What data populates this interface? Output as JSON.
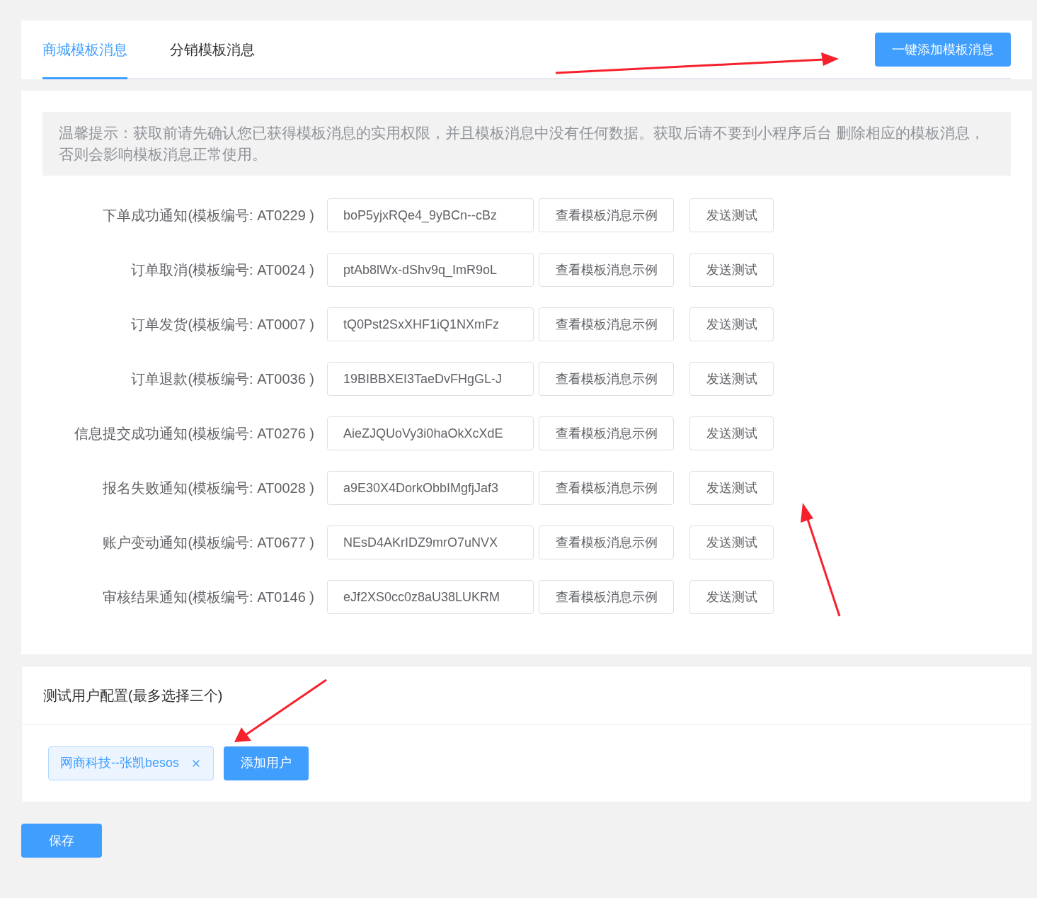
{
  "tabs": [
    {
      "label": "商城模板消息",
      "selected": true
    },
    {
      "label": "分销模板消息",
      "selected": false
    }
  ],
  "add_all_button": "一键添加模板消息",
  "notice": "温馨提示：获取前请先确认您已获得模板消息的实用权限，并且模板消息中没有任何数据。获取后请不要到小程序后台 删除相应的模板消息，否则会影响模板消息正常使用。",
  "templates": [
    {
      "label": "下单成功通知(模板编号: AT0229 )",
      "value": "boP5yjxRQe4_9yBCn--cBz",
      "view_button": "查看模板消息示例",
      "test_button": "发送测试"
    },
    {
      "label": "订单取消(模板编号: AT0024 )",
      "value": "ptAb8lWx-dShv9q_ImR9oL",
      "view_button": "查看模板消息示例",
      "test_button": "发送测试"
    },
    {
      "label": "订单发货(模板编号: AT0007 )",
      "value": "tQ0Pst2SxXHF1iQ1NXmFz",
      "view_button": "查看模板消息示例",
      "test_button": "发送测试"
    },
    {
      "label": "订单退款(模板编号: AT0036 )",
      "value": "19BIBBXEI3TaeDvFHgGL-J",
      "view_button": "查看模板消息示例",
      "test_button": "发送测试"
    },
    {
      "label": "信息提交成功通知(模板编号: AT0276 )",
      "value": "AieZJQUoVy3i0haOkXcXdE",
      "view_button": "查看模板消息示例",
      "test_button": "发送测试"
    },
    {
      "label": "报名失败通知(模板编号: AT0028 )",
      "value": "a9E30X4DorkObbIMgfjJaf3",
      "view_button": "查看模板消息示例",
      "test_button": "发送测试"
    },
    {
      "label": "账户变动通知(模板编号: AT0677 )",
      "value": "NEsD4AKrIDZ9mrO7uNVX",
      "view_button": "查看模板消息示例",
      "test_button": "发送测试"
    },
    {
      "label": "审核结果通知(模板编号: AT0146 )",
      "value": "eJf2XS0cc0z8aU38LUKRM",
      "view_button": "查看模板消息示例",
      "test_button": "发送测试"
    }
  ],
  "test_users": {
    "title": "测试用户配置(最多选择三个)",
    "tags": [
      "网商科技--张凯besos"
    ],
    "add_button": "添加用户"
  },
  "save_button": "保存"
}
